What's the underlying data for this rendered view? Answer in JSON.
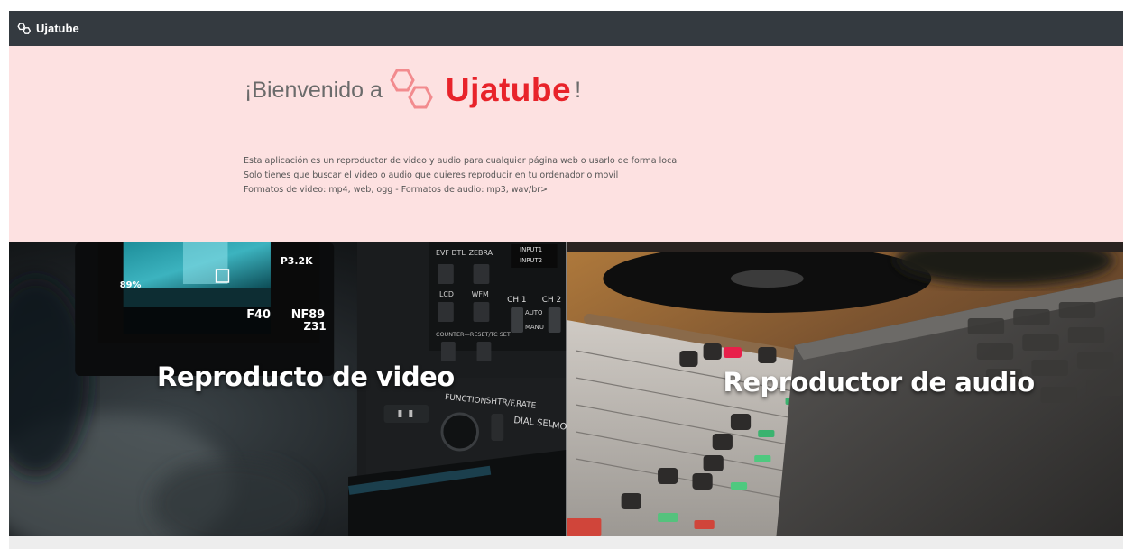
{
  "navbar": {
    "brand_text": "Ujatube",
    "brand_icon": "hexagon-logo-icon"
  },
  "hero": {
    "welcome_text": "¡Bienvenido a",
    "logo_text": "Ujatube",
    "exclamation": "!",
    "logo_icon": "hexagon-logo-icon",
    "description_lines": [
      "Esta aplicación es un reproductor de video y audio para cualquier página web o usarlo de forma local",
      "Solo tienes que buscar el video o audio que quieres reproducir en tu ordenador o movil",
      "Formatos de video: mp4, web, ogg - Formatos de audio: mp3, wav/br>"
    ]
  },
  "cards": {
    "video_label": "Reproducto de video",
    "audio_label": "Reproductor de audio",
    "camera_text": {
      "evf": "EVF DTL",
      "zebra": "ZEBRA",
      "input1": "INPUT1",
      "input2": "INPUT2",
      "lcd": "LCD",
      "wfm": "WFM",
      "ch1": "CH 1",
      "ch2": "CH 2",
      "auto": "AUTO",
      "manu": "MANU",
      "counter": "COUNTER—RESET/TC SET",
      "function": "FUNCTION",
      "shtr": "SHTR/F.RATE",
      "dial": "DIAL SEL",
      "mode": "MODE",
      "screen_p": "P3.2K",
      "screen_pct": "89%",
      "screen_f": "F40",
      "screen_nf": "NF89",
      "screen_z": "Z31"
    }
  },
  "colors": {
    "navbar_bg": "#343a40",
    "hero_bg": "#fde1e1",
    "brand_red": "#e8232a",
    "footer_bg": "#ededed"
  }
}
